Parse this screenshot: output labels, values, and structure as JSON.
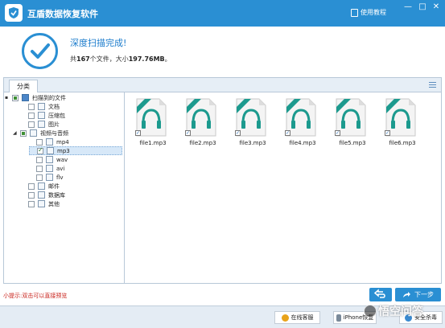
{
  "window": {
    "title": "互盾数据恢复软件",
    "help_label": "使用教程",
    "min_glyph": "—",
    "max_glyph": "□",
    "close_glyph": "✕"
  },
  "status": {
    "title": "深度扫描完成!",
    "summary_prefix": "共",
    "file_count": "167",
    "summary_mid": "个文件，大小",
    "total_size": "197.76MB",
    "summary_suffix": "。"
  },
  "panel": {
    "tab_label": "分类"
  },
  "tree": {
    "items": [
      {
        "label": "扫描到的文件",
        "expander": "▪",
        "check": "partial"
      },
      {
        "label": "文档",
        "expander": "",
        "check": "empty"
      },
      {
        "label": "压缩包",
        "expander": "",
        "check": "empty"
      },
      {
        "label": "图片",
        "expander": "",
        "check": "empty"
      },
      {
        "label": "视频与音频",
        "expander": "◢",
        "check": "partial"
      },
      {
        "label": "mp4",
        "expander": "",
        "check": "empty"
      },
      {
        "label": "mp3",
        "expander": "",
        "check": "checked"
      },
      {
        "label": "wav",
        "expander": "",
        "check": "empty"
      },
      {
        "label": "avi",
        "expander": "",
        "check": "empty"
      },
      {
        "label": "flv",
        "expander": "",
        "check": "empty"
      },
      {
        "label": "邮件",
        "expander": "",
        "check": "empty"
      },
      {
        "label": "数据库",
        "expander": "",
        "check": "empty"
      },
      {
        "label": "其他",
        "expander": "",
        "check": "empty"
      }
    ]
  },
  "files": [
    {
      "name": "file1.mp3",
      "checked": true
    },
    {
      "name": "file2.mp3",
      "checked": true
    },
    {
      "name": "file3.mp3",
      "checked": true
    },
    {
      "name": "file4.mp3",
      "checked": true
    },
    {
      "name": "file5.mp3",
      "checked": true
    },
    {
      "name": "file6.mp3",
      "checked": true
    }
  ],
  "bottom": {
    "hint": "小提示:双击可以直接预览",
    "next_label": "下一步"
  },
  "footer": {
    "online_service": "在线客服",
    "iphone_label": "iPhone恢复",
    "security_label": "安全杀毒"
  },
  "watermark": {
    "text": "悟空问答"
  },
  "colors": {
    "accent": "#2a8fd3",
    "hint": "#c8211a",
    "audio_icon": "#1c9a8e"
  }
}
